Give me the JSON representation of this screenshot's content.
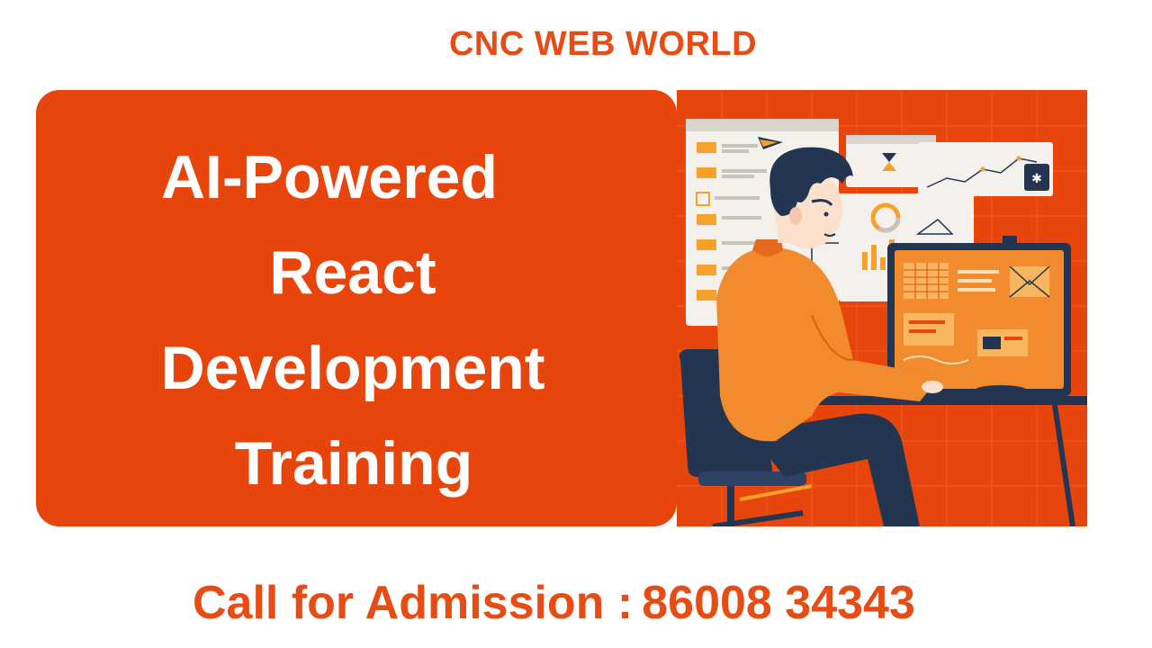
{
  "brand": {
    "name": "CNC WEB WORLD"
  },
  "banner": {
    "title_lines": [
      "AI-Powered",
      "React",
      "Development",
      "Training"
    ]
  },
  "contact": {
    "label": "Call for Admission :",
    "phone": "86008 34343"
  },
  "illustration": {
    "subject": "developer-at-computer-illustration",
    "colors": {
      "background": "#e8450c",
      "accent": "#f7a12c",
      "navy": "#243552",
      "panel": "#f4f1ec"
    }
  }
}
